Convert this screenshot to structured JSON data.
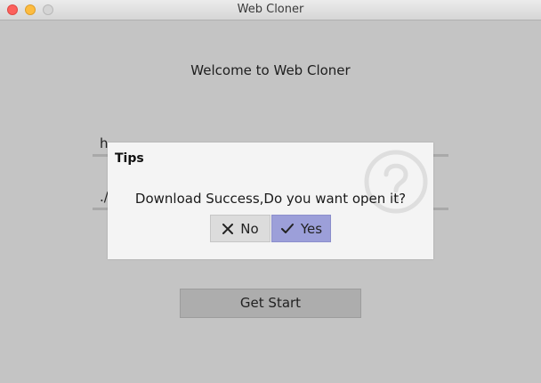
{
  "window": {
    "title": "Web Cloner"
  },
  "main": {
    "welcome": "Welcome to Web Cloner",
    "url_value": "h",
    "path_value": "./",
    "start_label": "Get Start"
  },
  "dialog": {
    "title": "Tips",
    "message": "Download Success,Do you want open it?",
    "no_label": "No",
    "yes_label": "Yes",
    "icon": "question-icon"
  },
  "colors": {
    "background": "#c4c4c4",
    "dialog": "#f4f4f4",
    "yes_button": "#9c9fd9",
    "no_button": "#dcdcdc"
  }
}
